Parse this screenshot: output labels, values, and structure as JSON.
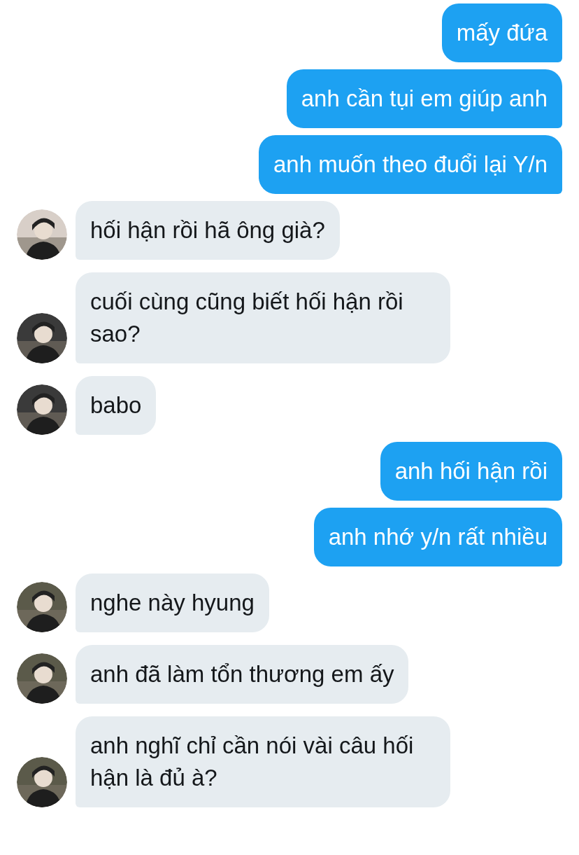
{
  "messages": [
    {
      "kind": "sent",
      "text": "mấy đứa"
    },
    {
      "kind": "sent",
      "text": "anh cần tụi em giúp anh"
    },
    {
      "kind": "sent",
      "text": "anh muốn theo đuổi lại Y/n"
    },
    {
      "kind": "received",
      "text": "hối hận rồi hã ông già?"
    },
    {
      "kind": "received",
      "text": "cuối cùng cũng biết hối hận rồi sao?"
    },
    {
      "kind": "received",
      "text": "babo"
    },
    {
      "kind": "sent",
      "text": "anh hối hận rồi"
    },
    {
      "kind": "sent",
      "text": "anh nhớ y/n rất nhiều"
    },
    {
      "kind": "received",
      "text": "nghe này hyung"
    },
    {
      "kind": "received",
      "text": "anh đã làm tổn thương em ấy"
    },
    {
      "kind": "received",
      "text": "anh nghĩ chỉ cần nói vài câu hối hận là đủ à?"
    }
  ]
}
